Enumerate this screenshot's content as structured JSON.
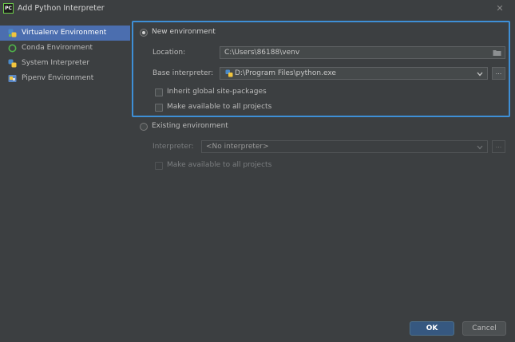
{
  "window": {
    "title": "Add Python Interpreter",
    "app_icon_text": "PC",
    "close_glyph": "✕"
  },
  "sidebar": {
    "items": [
      {
        "label": "Virtualenv Environment",
        "icon": "virtualenv-icon",
        "selected": true
      },
      {
        "label": "Conda Environment",
        "icon": "conda-icon",
        "selected": false
      },
      {
        "label": "System Interpreter",
        "icon": "python-icon",
        "selected": false
      },
      {
        "label": "Pipenv Environment",
        "icon": "pipenv-icon",
        "selected": false
      }
    ]
  },
  "new_env": {
    "radio_label": "New environment",
    "selected": true,
    "location_label": "Location:",
    "location_value": "C:\\Users\\86188\\venv",
    "base_interpreter_label": "Base interpreter:",
    "base_interpreter_value": "D:\\Program Files\\python.exe",
    "browse_glyph": "...",
    "inherit_label": "Inherit global site-packages",
    "make_available_label": "Make available to all projects"
  },
  "existing_env": {
    "radio_label": "Existing environment",
    "selected": false,
    "interpreter_label": "Interpreter:",
    "interpreter_value": "<No interpreter>",
    "browse_glyph": "...",
    "make_available_label": "Make available to all projects"
  },
  "buttons": {
    "ok": "OK",
    "cancel": "Cancel"
  },
  "colors": {
    "accent": "#3e8fd6",
    "selection": "#4b6eaf",
    "ok_button": "#365880",
    "background": "#3c3f41"
  }
}
